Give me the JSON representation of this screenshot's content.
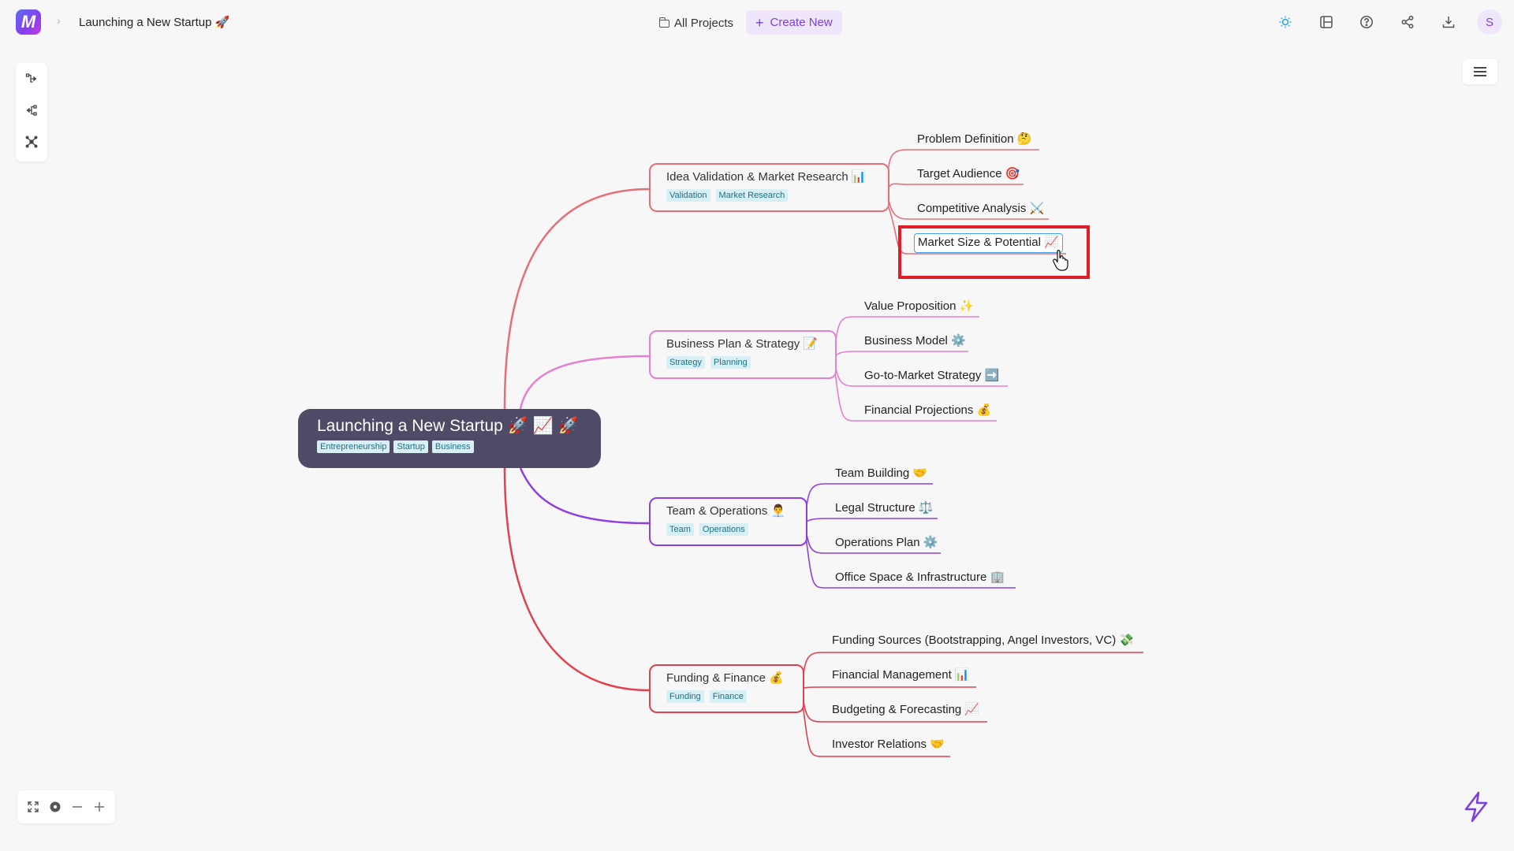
{
  "header": {
    "breadcrumb_title": "Launching a New Startup 🚀",
    "all_projects_label": "All Projects",
    "create_new_label": "Create New",
    "avatar_initial": "S"
  },
  "mindmap": {
    "root": {
      "title": "Launching a New Startup 🚀 📈 🚀",
      "tags": [
        "Entrepreneurship",
        "Startup",
        "Business"
      ]
    },
    "branches": [
      {
        "title": "Idea Validation & Market Research 📊",
        "tags": [
          "Validation",
          "Market Research"
        ],
        "color": "#e56f78",
        "children": [
          "Problem Definition 🤔",
          "Target Audience 🎯",
          "Competitive Analysis ⚔️",
          "Market Size & Potential 📈"
        ]
      },
      {
        "title": "Business Plan & Strategy 📝",
        "tags": [
          "Strategy",
          "Planning"
        ],
        "color": "#e57fcf",
        "children": [
          "Value Proposition ✨",
          "Business Model ⚙️",
          "Go-to-Market Strategy ➡️",
          "Financial Projections 💰"
        ]
      },
      {
        "title": "Team & Operations 👨‍💼",
        "tags": [
          "Team",
          "Operations"
        ],
        "color": "#8e3fe0",
        "children": [
          "Team Building 🤝",
          "Legal Structure ⚖️",
          "Operations Plan ⚙️",
          "Office Space & Infrastructure 🏢"
        ]
      },
      {
        "title": "Funding & Finance 💰",
        "tags": [
          "Funding",
          "Finance"
        ],
        "color": "#e0414f",
        "children": [
          "Funding Sources (Bootstrapping, Angel Investors, VC) 💸",
          "Financial Management 📊",
          "Budgeting & Forecasting 📈",
          "Investor Relations 🤝"
        ]
      }
    ]
  },
  "colors": {
    "accent": "#7b3fe0",
    "root_bg": "#4f4a66",
    "tag_bg": "#d7f0f6",
    "selection_highlight": "#e01e2a"
  }
}
